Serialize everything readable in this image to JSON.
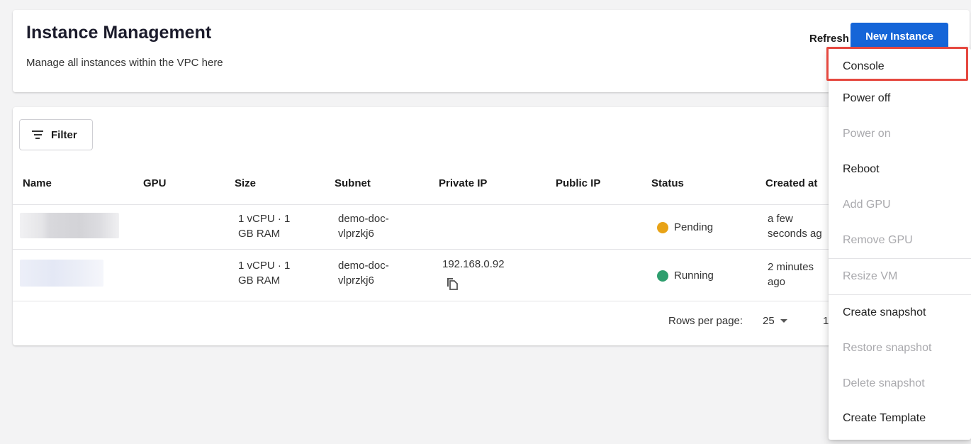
{
  "header": {
    "title": "Instance Management",
    "subtitle": "Manage all instances within the VPC here",
    "refresh_label": "Refresh",
    "new_instance_label": "New Instance"
  },
  "toolbar": {
    "filter_label": "Filter"
  },
  "table": {
    "columns": [
      "Name",
      "GPU",
      "Size",
      "Subnet",
      "Private IP",
      "Public IP",
      "Status",
      "Created at"
    ],
    "rows": [
      {
        "name": "",
        "gpu": "",
        "size_line1": "1 vCPU · 1",
        "size_line2": "GB RAM",
        "subnet_line1": "demo-doc-",
        "subnet_line2": "vlprzkj6",
        "private_ip": "",
        "public_ip": "",
        "status": "Pending",
        "status_color": "#e8a317",
        "created_line1": "a few",
        "created_line2": "seconds ag"
      },
      {
        "name": "",
        "gpu": "",
        "size_line1": "1 vCPU · 1",
        "size_line2": "GB RAM",
        "subnet_line1": "demo-doc-",
        "subnet_line2": "vlprzkj6",
        "private_ip": "192.168.0.92",
        "public_ip": "",
        "status": "Running",
        "status_color": "#2e9e6e",
        "created_line1": "2 minutes",
        "created_line2": "ago"
      }
    ]
  },
  "pagination": {
    "rows_per_page_label": "Rows per page:",
    "rows_per_page_value": "25",
    "page_text": "1"
  },
  "menu": {
    "items": [
      {
        "label": "Console",
        "enabled": true,
        "highlighted": true
      },
      {
        "label": "Power off",
        "enabled": true
      },
      {
        "label": "Power on",
        "enabled": false
      },
      {
        "label": "Reboot",
        "enabled": true
      },
      {
        "label": "Add GPU",
        "enabled": false
      },
      {
        "label": "Remove GPU",
        "enabled": false
      },
      {
        "label": "Resize VM",
        "enabled": false
      },
      {
        "label": "Create snapshot",
        "enabled": true
      },
      {
        "label": "Restore snapshot",
        "enabled": false
      },
      {
        "label": "Delete snapshot",
        "enabled": false
      },
      {
        "label": "Create Template",
        "enabled": true
      }
    ]
  },
  "colors": {
    "primary": "#1565d8",
    "highlight_border": "#e5483f",
    "pending": "#e8a317",
    "running": "#2e9e6e",
    "disabled_text": "#a9a9ad"
  }
}
